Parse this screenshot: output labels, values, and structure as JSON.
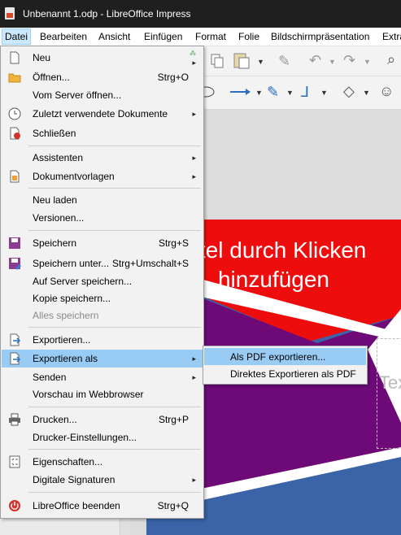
{
  "window": {
    "title": "Unbenannt 1.odp - LibreOffice Impress"
  },
  "menubar": [
    "Datei",
    "Bearbeiten",
    "Ansicht",
    "Einfügen",
    "Format",
    "Folie",
    "Bildschirmpräsentation",
    "Extra"
  ],
  "file_menu": {
    "new": "Neu",
    "open": "Öffnen...",
    "open_shortcut": "Strg+O",
    "open_remote": "Vom Server öffnen...",
    "recent": "Zuletzt verwendete Dokumente",
    "close": "Schließen",
    "wizards": "Assistenten",
    "templates": "Dokumentvorlagen",
    "reload": "Neu laden",
    "versions": "Versionen...",
    "save": "Speichern",
    "save_shortcut": "Strg+S",
    "save_as": "Speichern unter...",
    "save_as_shortcut": "Strg+Umschalt+S",
    "save_remote": "Auf Server speichern...",
    "save_copy": "Kopie speichern...",
    "save_all": "Alles speichern",
    "export": "Exportieren...",
    "export_as": "Exportieren als",
    "send": "Senden",
    "preview_browser": "Vorschau im Webbrowser",
    "print": "Drucken...",
    "print_shortcut": "Strg+P",
    "printer_settings": "Drucker-Einstellungen...",
    "properties": "Eigenschaften...",
    "digital_signatures": "Digitale Signaturen",
    "exit": "LibreOffice beenden",
    "exit_shortcut": "Strg+Q"
  },
  "submenu": {
    "export_pdf": "Als PDF exportieren...",
    "export_pdf_direct": "Direktes Exportieren als PDF"
  },
  "slide": {
    "title_line1": "Titel durch Klicken",
    "title_line2": "hinzufügen",
    "subtitle_partial": "Tex"
  },
  "colors": {
    "slide_red": "#ee0d0d",
    "slide_purple": "#6e0a78",
    "slide_blue": "#3a63a8",
    "highlight": "#99ccf5"
  }
}
